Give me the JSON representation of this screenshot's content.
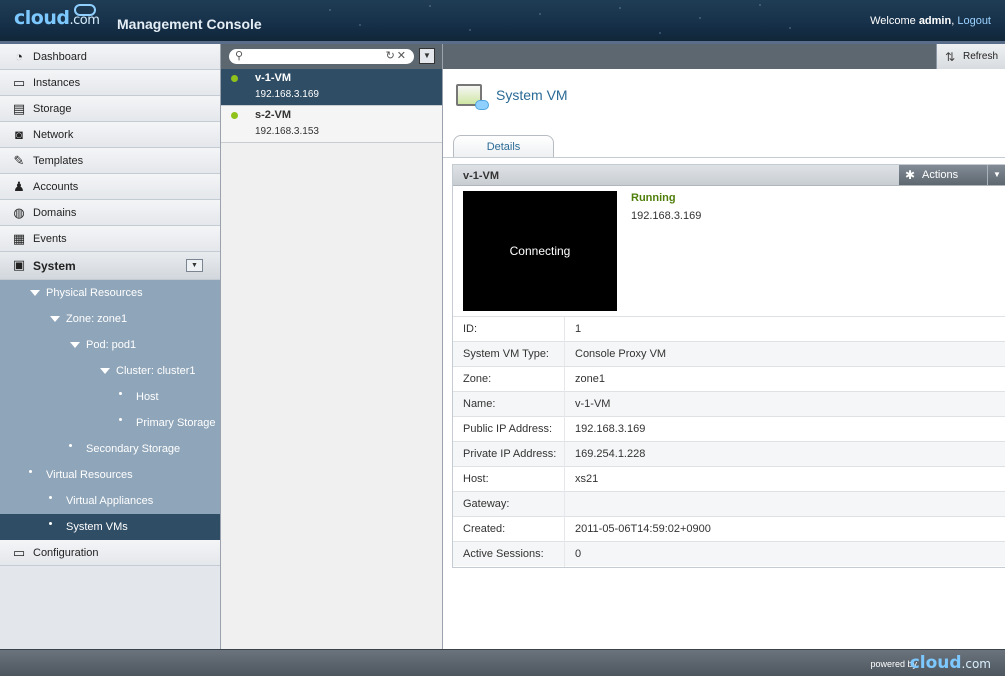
{
  "header": {
    "logo_main": "cloud",
    "logo_suffix": ".com",
    "title": "Management Console",
    "welcome": "Welcome",
    "username": "admin",
    "separator": ",",
    "logout": "Logout"
  },
  "nav": {
    "items": [
      {
        "label": "Dashboard",
        "icon": "dashboard-icon",
        "glyph": "◔"
      },
      {
        "label": "Instances",
        "icon": "instances-icon",
        "glyph": "▭"
      },
      {
        "label": "Storage",
        "icon": "storage-icon",
        "glyph": "▤"
      },
      {
        "label": "Network",
        "icon": "network-icon",
        "glyph": "◙"
      },
      {
        "label": "Templates",
        "icon": "templates-icon",
        "glyph": "✎"
      },
      {
        "label": "Accounts",
        "icon": "accounts-icon",
        "glyph": "♟"
      },
      {
        "label": "Domains",
        "icon": "domains-icon",
        "glyph": "◍"
      },
      {
        "label": "Events",
        "icon": "events-icon",
        "glyph": "▦"
      },
      {
        "label": "System",
        "icon": "system-icon",
        "glyph": "▣"
      }
    ],
    "tree": [
      {
        "label": "Physical Resources",
        "type": "tri",
        "indent": 30
      },
      {
        "label": "Zone: zone1",
        "type": "tri",
        "indent": 50
      },
      {
        "label": "Pod: pod1",
        "type": "tri",
        "indent": 70
      },
      {
        "label": "Cluster: cluster1",
        "type": "tri",
        "indent": 100
      },
      {
        "label": "Host",
        "type": "bullet",
        "indent": 119
      },
      {
        "label": "Primary Storage",
        "type": "bullet",
        "indent": 119
      },
      {
        "label": "Secondary Storage",
        "type": "bullet",
        "indent": 69
      },
      {
        "label": "Virtual Resources",
        "type": "bullet",
        "indent": 29
      },
      {
        "label": "Virtual Appliances",
        "type": "bullet",
        "indent": 49
      },
      {
        "label": "System VMs",
        "type": "bullet",
        "indent": 49,
        "selected": true
      }
    ],
    "config": {
      "label": "Configuration",
      "icon": "configuration-icon",
      "glyph": "▭"
    }
  },
  "search": {
    "placeholder": "",
    "value": ""
  },
  "vm_list": [
    {
      "name": "v-1-VM",
      "ip": "192.168.3.169",
      "selected": true
    },
    {
      "name": "s-2-VM",
      "ip": "192.168.3.153",
      "selected": false
    }
  ],
  "toolbar": {
    "refresh": "Refresh"
  },
  "content": {
    "title": "System VM",
    "tab": "Details",
    "panel_name": "v-1-VM",
    "actions": "Actions",
    "console_text": "Connecting",
    "state": "Running",
    "state_ip": "192.168.3.169",
    "details": [
      {
        "label": "ID:",
        "value": "1"
      },
      {
        "label": "System VM Type:",
        "value": "Console Proxy VM"
      },
      {
        "label": "Zone:",
        "value": "zone1"
      },
      {
        "label": "Name:",
        "value": "v-1-VM"
      },
      {
        "label": "Public IP Address:",
        "value": "192.168.3.169"
      },
      {
        "label": "Private IP Address:",
        "value": "169.254.1.228"
      },
      {
        "label": "Host:",
        "value": "xs21"
      },
      {
        "label": "Gateway:",
        "value": ""
      },
      {
        "label": "Created:",
        "value": "2011-05-06T14:59:02+0900"
      },
      {
        "label": "Active Sessions:",
        "value": "0"
      }
    ]
  },
  "footer": {
    "powered_by": "powered by",
    "logo_main": "cloud",
    "logo_suffix": ".com"
  },
  "colors": {
    "accent": "#2a6a96",
    "selected": "#2f4d65",
    "running": "#4f7f0a",
    "state_dot": "#8fc21b"
  }
}
